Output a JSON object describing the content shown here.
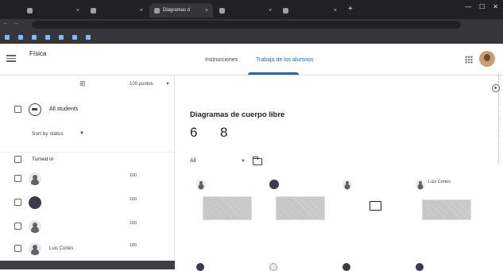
{
  "browser": {
    "tabs": [
      {
        "label": "",
        "active": false
      },
      {
        "label": "",
        "active": false
      },
      {
        "label": "Diagramas d",
        "active": true
      },
      {
        "label": "",
        "active": false
      },
      {
        "label": "",
        "active": false
      }
    ],
    "address": "",
    "bookmarks": [
      "",
      "",
      "",
      "",
      "",
      "",
      "",
      "",
      ""
    ]
  },
  "header": {
    "class_name": "Física",
    "class_sub": "",
    "tabs": [
      "Instrucciones",
      "Trabajo de los alumnos"
    ],
    "active_tab": 1
  },
  "roster": {
    "toolbar_mail": "",
    "toolbar_points": "100 puntos",
    "all_students": "All students",
    "sort_by": "Sort by status",
    "section": "Turned in",
    "students": [
      {
        "name": "",
        "grade": "100",
        "den": "",
        "avatar": "ph"
      },
      {
        "name": "",
        "grade": "100",
        "den": "",
        "avatar": "dark"
      },
      {
        "name": "",
        "grade": "100",
        "den": "",
        "avatar": "ph"
      },
      {
        "name": "Luis Cortés",
        "grade": "100",
        "den": "",
        "avatar": "ph"
      }
    ]
  },
  "main": {
    "assignment_title": "Diagramas de cuerpo libre",
    "stats": [
      {
        "num": "6",
        "label": ""
      },
      {
        "num": "8",
        "label": ""
      }
    ],
    "filter": "All",
    "cards": [
      {
        "name": "",
        "thumb": "texture",
        "text": "",
        "sub": ""
      },
      {
        "name": "",
        "thumb": "texture",
        "text": "",
        "sub": ""
      },
      {
        "name": "",
        "thumb": "white",
        "text": "",
        "sub": ""
      },
      {
        "name": "Luis Cortés",
        "thumb": "tall",
        "text": "",
        "sub": ""
      }
    ],
    "bottom_names": [
      "",
      "",
      "",
      ""
    ]
  },
  "status_bar": ""
}
